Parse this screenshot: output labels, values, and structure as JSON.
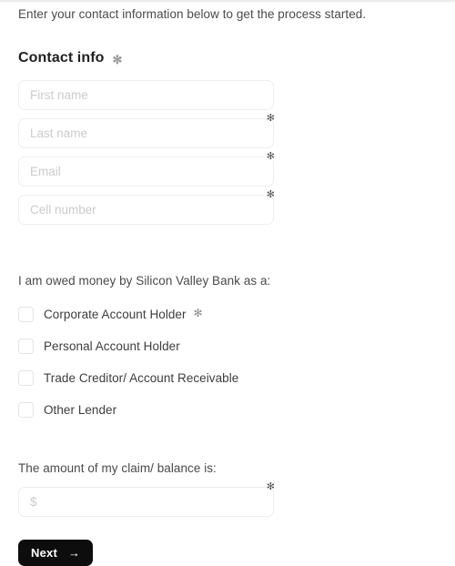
{
  "form": {
    "intro_text": "Enter your contact information below to get the process started.",
    "contact_section": {
      "heading": "Contact info",
      "required_marker": "✻",
      "fields": [
        {
          "name": "first-name",
          "placeholder": "First name",
          "value": "",
          "required_marker": ""
        },
        {
          "name": "last-name",
          "placeholder": "Last name",
          "value": "",
          "required_marker": "✻"
        },
        {
          "name": "email",
          "placeholder": "Email",
          "value": "",
          "required_marker": "✻"
        },
        {
          "name": "cell-number",
          "placeholder": "Cell number",
          "value": "",
          "required_marker": "✻"
        }
      ]
    },
    "owed_section": {
      "label": "I am owed money by Silicon Valley Bank as a:",
      "options": [
        {
          "label": "Corporate Account Holder",
          "checked": false,
          "required_marker": "✻"
        },
        {
          "label": "Personal Account Holder",
          "checked": false,
          "required_marker": ""
        },
        {
          "label": "Trade Creditor/ Account Receivable",
          "checked": false,
          "required_marker": ""
        },
        {
          "label": "Other Lender",
          "checked": false,
          "required_marker": ""
        }
      ]
    },
    "amount_section": {
      "label": "The amount of my claim/ balance is:",
      "placeholder": "$",
      "value": "",
      "required_marker": "✻"
    },
    "submit": {
      "label": "Next",
      "arrow": "→"
    }
  },
  "colors": {
    "button_background": "#0d0d0d",
    "button_text": "#ffffff",
    "input_border": "#eceef0",
    "placeholder_text": "#c9cbcd",
    "body_text": "#3d3d3d",
    "heading_text": "#1f1f1f"
  }
}
